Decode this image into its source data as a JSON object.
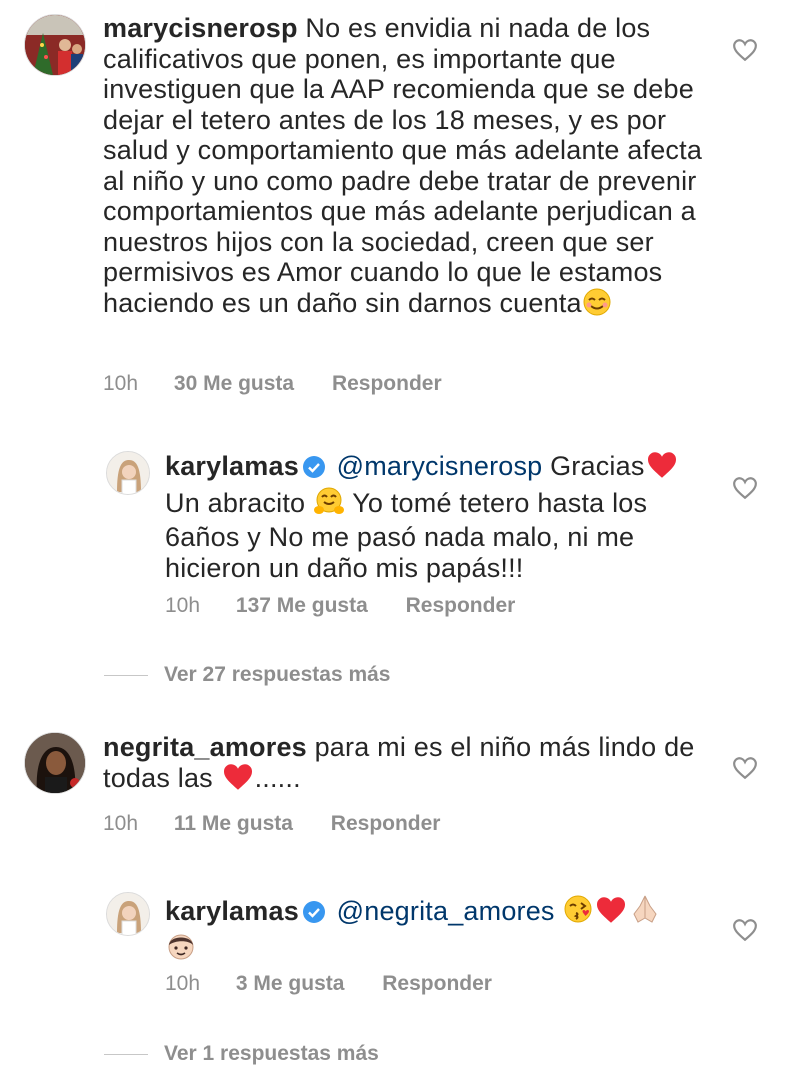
{
  "comments": [
    {
      "username": "marycisnerosp",
      "text": "No es envidia ni nada de los calificativos que ponen, es importante que investiguen que la AAP recomienda que se debe dejar el tetero antes de los 18 meses, y es por salud y comportamiento que más adelante afecta al niño y uno como padre debe tratar de prevenir comportamientos que más adelante perjudican a nuestros hijos con la sociedad, creen que ser permisivos es Amor cuando lo que le estamos haciendo es un daño sin darnos cuenta",
      "time": "10h",
      "likes": "30 Me gusta",
      "reply": "Responder",
      "replies": [
        {
          "username": "karylamas",
          "mention": "@marycisnerosp",
          "text_a": "Gracias",
          "text_b": "Un abracito",
          "text_c": "Yo tomé tetero hasta los 6años y No me pasó nada malo, ni me hicieron un daño mis papás!!!",
          "time": "10h",
          "likes": "137 Me gusta",
          "reply": "Responder"
        }
      ],
      "view_more": "Ver 27 respuestas más"
    },
    {
      "username": "negrita_amores",
      "text_a": "para mi es el niño más lindo de todas las",
      "text_b": "......",
      "time": "10h",
      "likes": "11 Me gusta",
      "reply": "Responder",
      "replies": [
        {
          "username": "karylamas",
          "mention": "@negrita_amores",
          "time": "10h",
          "likes": "3 Me gusta",
          "reply": "Responder"
        }
      ],
      "view_more": "Ver 1 respuestas más"
    }
  ],
  "icons": {
    "like": "heart-outline-icon",
    "verified": "verified-badge-icon"
  },
  "colors": {
    "text": "#262626",
    "secondary": "#8e8e8e",
    "mention": "#00376b",
    "verified": "#3897f0",
    "heart_red": "#ed2b3a"
  }
}
